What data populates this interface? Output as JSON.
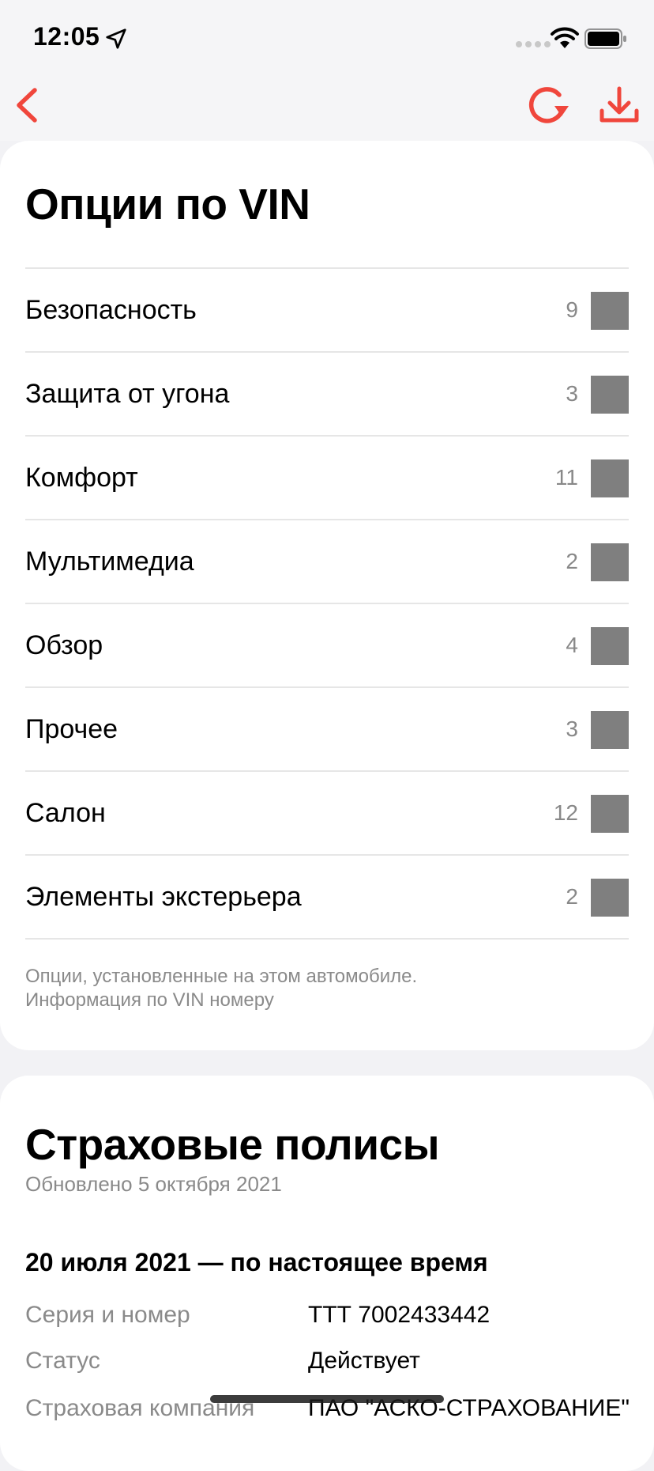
{
  "status_bar": {
    "time": "12:05",
    "icons": [
      "location-arrow-icon",
      "cellular-signal-icon",
      "wifi-icon",
      "battery-icon"
    ]
  },
  "nav": {
    "accent_color": "#f0463c",
    "icons": [
      "back-chevron-icon",
      "refresh-icon",
      "download-icon"
    ]
  },
  "options": {
    "title": "Опции по VIN",
    "items": [
      {
        "label": "Безопасность",
        "count": "9"
      },
      {
        "label": "Защита от угона",
        "count": "3"
      },
      {
        "label": "Комфорт",
        "count": "11"
      },
      {
        "label": "Мультимедиа",
        "count": "2"
      },
      {
        "label": "Обзор",
        "count": "4"
      },
      {
        "label": "Прочее",
        "count": "3"
      },
      {
        "label": "Салон",
        "count": "12"
      },
      {
        "label": "Элементы экстерьера",
        "count": "2"
      }
    ],
    "note_line1": "Опции, установленные на этом автомобиле.",
    "note_line2": "Информация по VIN номеру"
  },
  "policies": {
    "title": "Страховые полисы",
    "updated": "Обновлено 5 октября 2021",
    "period": "20 июля 2021 — по настоящее время",
    "rows": [
      {
        "label": "Серия и номер",
        "value": "ТТТ 7002433442"
      },
      {
        "label": "Статус",
        "value": "Действует"
      },
      {
        "label": "Страховая компания",
        "value": "ПАО \"АСКО-СТРАХОВАНИЕ\""
      }
    ]
  }
}
